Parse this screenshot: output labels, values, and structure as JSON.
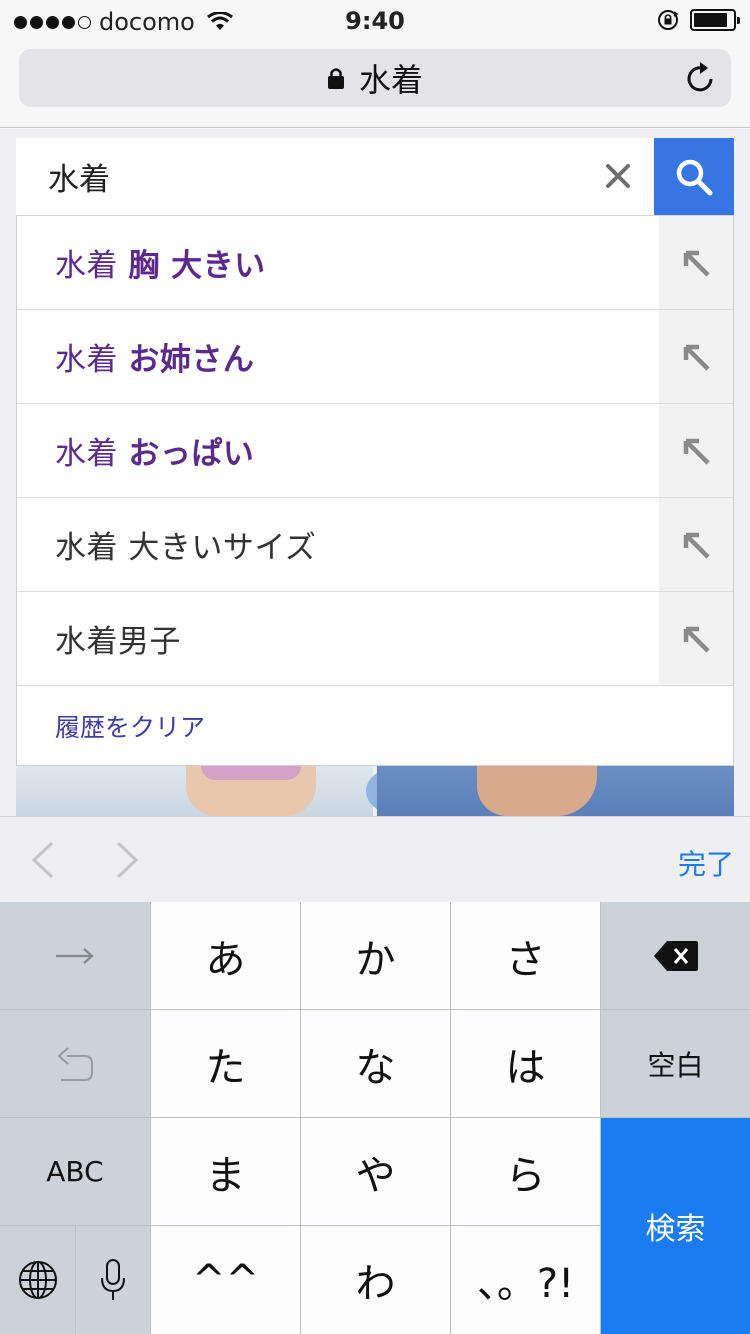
{
  "status_bar": {
    "carrier": "docomo",
    "time": "9:40"
  },
  "address_bar": {
    "title": "水着"
  },
  "search": {
    "value": "水着"
  },
  "suggestions": [
    {
      "prefix": "水着",
      "rest": "胸 大きい",
      "visited": true
    },
    {
      "prefix": "水着",
      "rest": "お姉さん",
      "visited": true
    },
    {
      "prefix": "水着",
      "rest": "おっぱい",
      "visited": true
    },
    {
      "prefix": "水着",
      "rest": "大きいサイズ",
      "visited": false
    },
    {
      "prefix": "",
      "rest": "水着男子",
      "visited": false
    }
  ],
  "clear_history_label": "履歴をクリア",
  "accessory": {
    "done_label": "完了"
  },
  "keyboard": {
    "keys": {
      "a": "あ",
      "ka": "か",
      "sa": "さ",
      "ta": "た",
      "na": "な",
      "ha": "は",
      "ma": "ま",
      "ya": "や",
      "ra": "ら",
      "kaomoji": "^^",
      "wa": "わ",
      "punct": "、。?!",
      "space": "空白",
      "abc": "ABC",
      "search": "検索"
    }
  },
  "colors": {
    "accent_blue": "#1a7cf0",
    "search_button": "#3776e2",
    "visited_link": "#5c2a8f",
    "clear_history_link": "#3d3da5"
  }
}
